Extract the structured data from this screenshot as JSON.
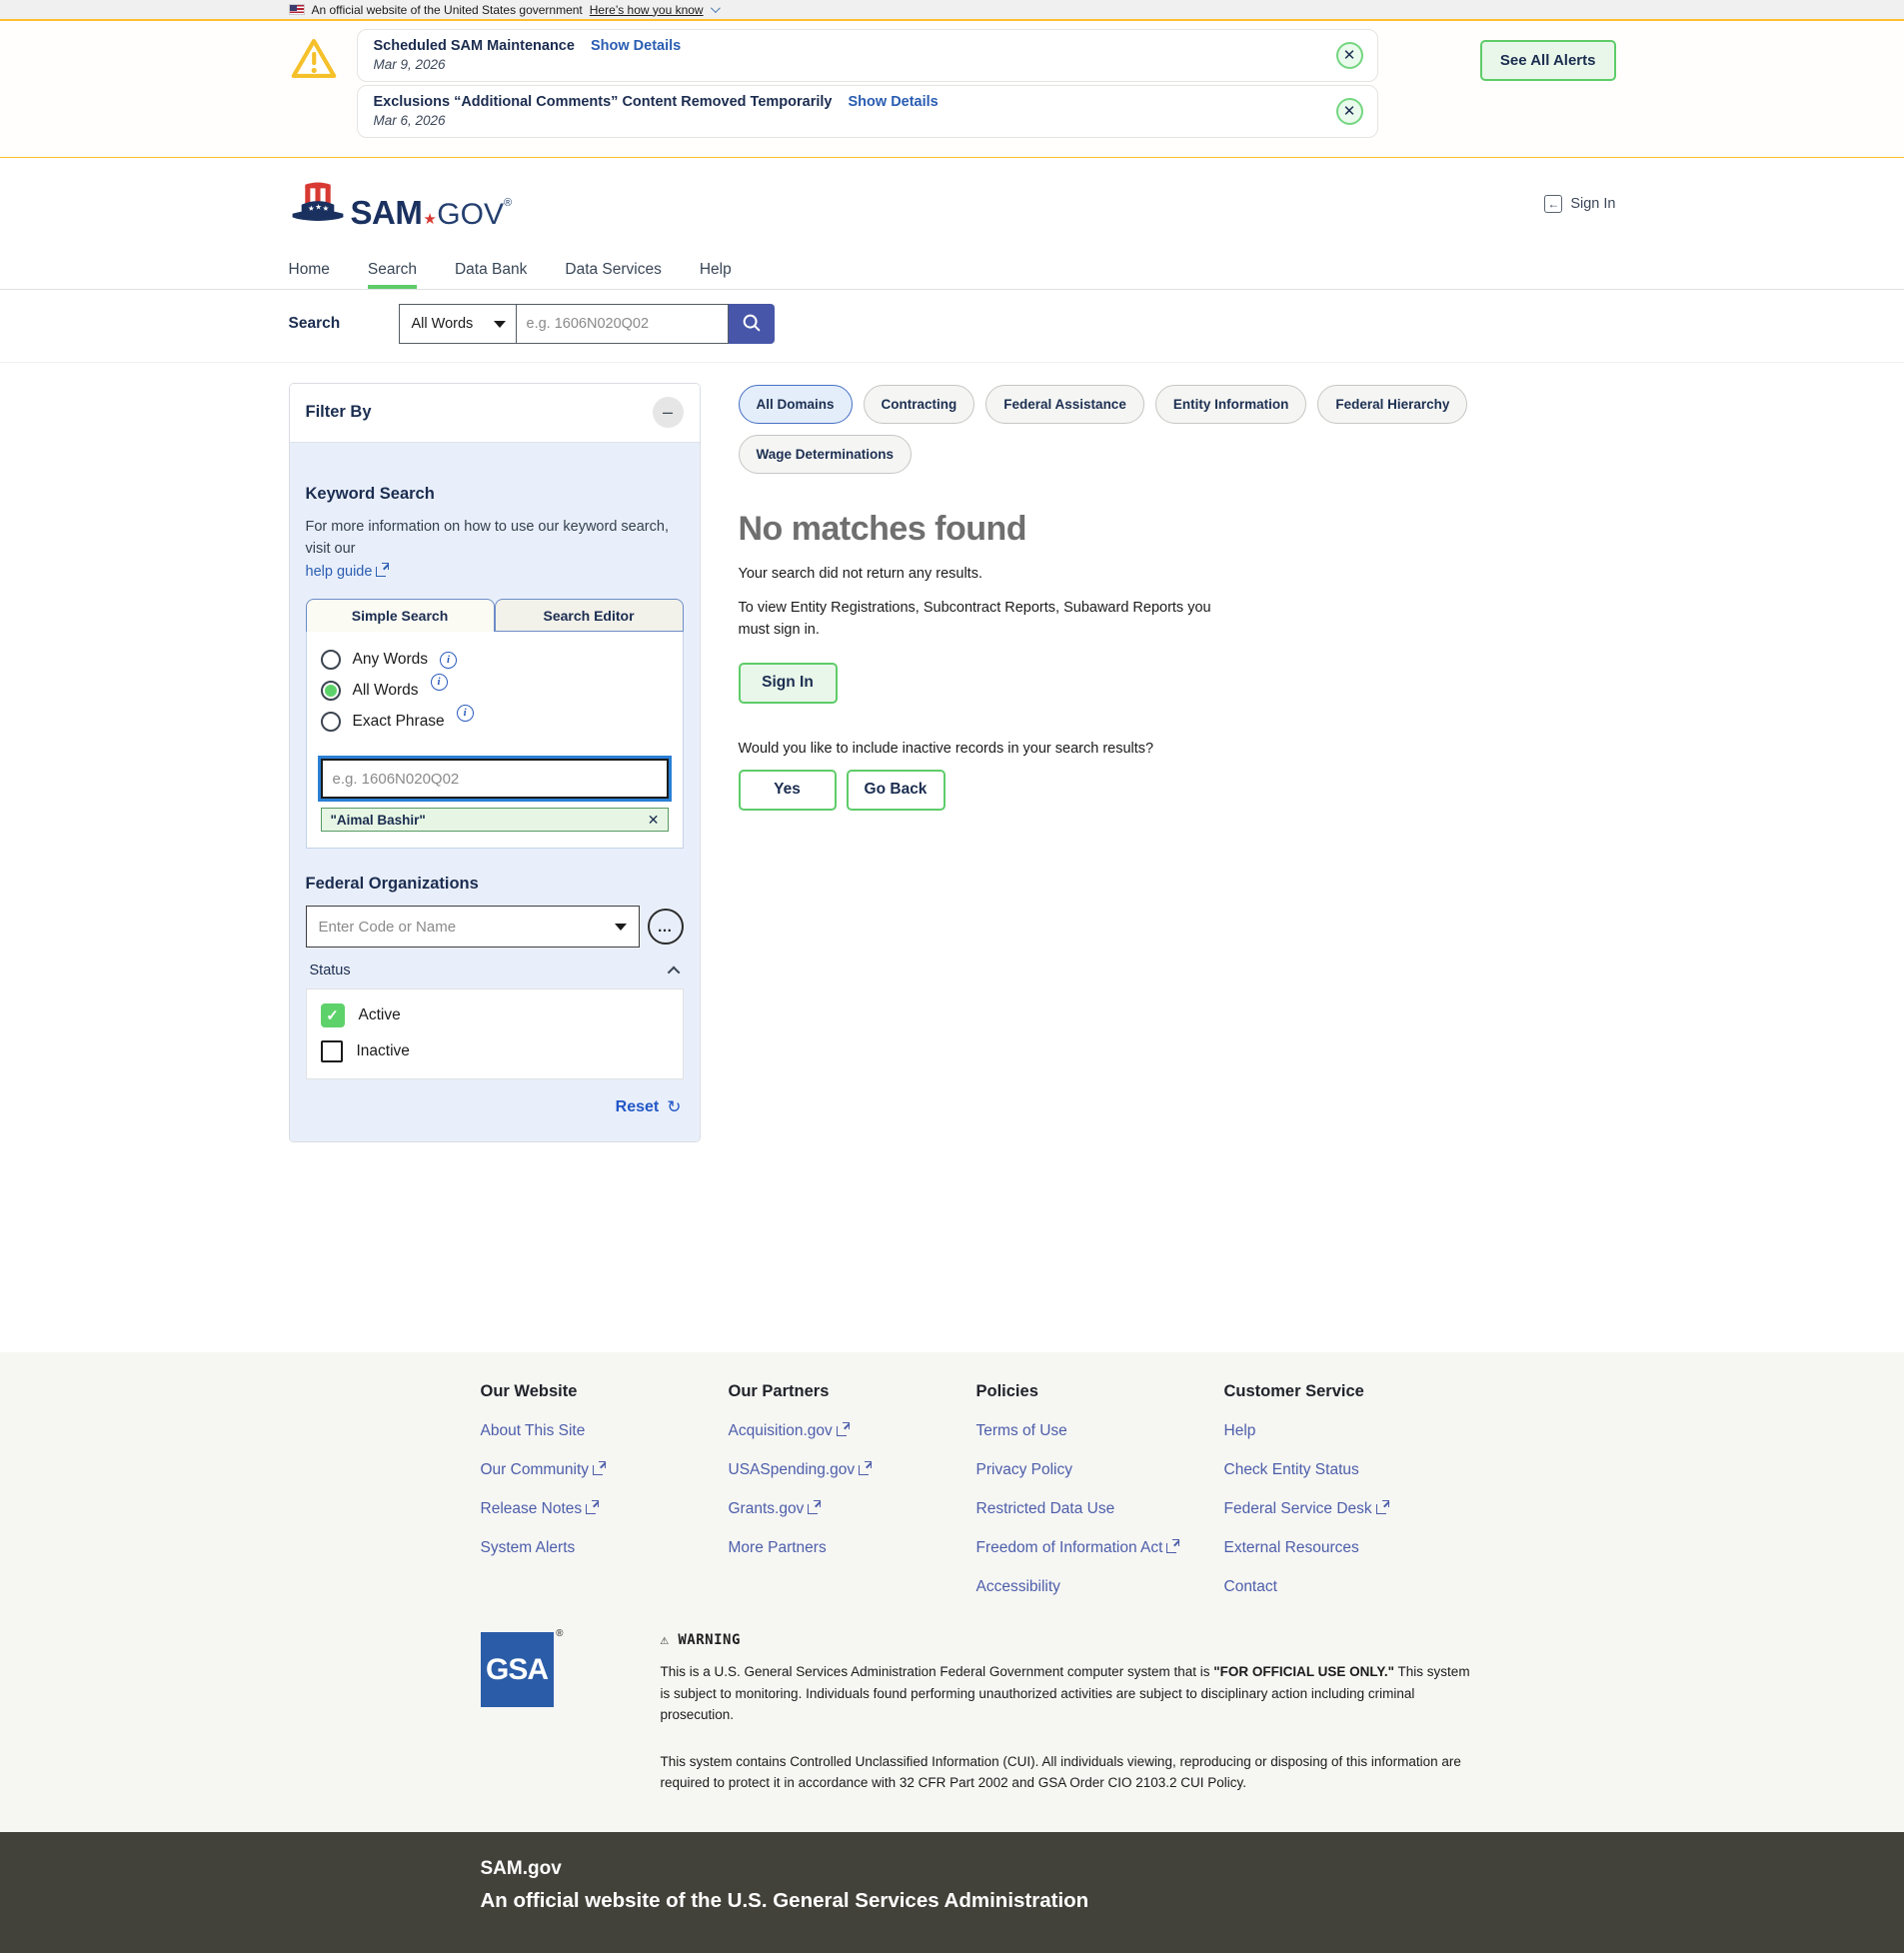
{
  "banner": {
    "text": "An official website of the United States government",
    "link": "Here’s how you know"
  },
  "alerts": {
    "items": [
      {
        "title": "Scheduled SAM Maintenance",
        "link": "Show Details",
        "date": "Mar 9, 2026"
      },
      {
        "title": "Exclusions “Additional Comments” Content Removed Temporarily",
        "link": "Show Details",
        "date": "Mar 6, 2026"
      }
    ],
    "see_all_label": "See All Alerts"
  },
  "header": {
    "logo_sam": "SAM",
    "logo_star": "★",
    "logo_gov": "GOV",
    "logo_reg": "®",
    "sign_in": "Sign In"
  },
  "nav": {
    "items": [
      {
        "label": "Home"
      },
      {
        "label": "Search"
      },
      {
        "label": "Data Bank"
      },
      {
        "label": "Data Services"
      },
      {
        "label": "Help"
      }
    ]
  },
  "searchbar": {
    "label": "Search",
    "mode_value": "All Words",
    "placeholder": "e.g. 1606N020Q02"
  },
  "filter": {
    "title": "Filter By",
    "keyword": {
      "heading": "Keyword Search",
      "info": "For more information on how to use our keyword search, visit our",
      "help_link": "help guide",
      "tabs": [
        {
          "label": "Simple Search"
        },
        {
          "label": "Search Editor"
        }
      ],
      "radios": [
        {
          "label": "Any Words"
        },
        {
          "label": "All Words"
        },
        {
          "label": "Exact Phrase"
        }
      ],
      "input_placeholder": "e.g. 1606N020Q02",
      "chip_label": "\"Aimal Bashir\""
    },
    "federal_orgs": {
      "heading": "Federal Organizations",
      "placeholder": "Enter Code or Name"
    },
    "status": {
      "heading": "Status",
      "options": [
        {
          "label": "Active",
          "checked": true
        },
        {
          "label": "Inactive",
          "checked": false
        }
      ]
    },
    "reset_label": "Reset"
  },
  "results": {
    "domains": [
      {
        "label": "All Domains"
      },
      {
        "label": "Contracting"
      },
      {
        "label": "Federal Assistance"
      },
      {
        "label": "Entity Information"
      },
      {
        "label": "Federal Hierarchy"
      },
      {
        "label": "Wage Determinations"
      }
    ],
    "title": "No matches found",
    "subtitle": "Your search did not return any results.",
    "signin_note": "To view Entity Registrations, Subcontract Reports, Subaward Reports you must sign in.",
    "signin_button": "Sign In",
    "inactive_question": "Would you like to include inactive records in your search results?",
    "yes_button": "Yes",
    "goback_button": "Go Back"
  },
  "footer": {
    "columns": [
      {
        "heading": "Our Website",
        "links": [
          {
            "label": "About This Site"
          },
          {
            "label": "Our Community"
          },
          {
            "label": "Release Notes"
          },
          {
            "label": "System Alerts"
          }
        ]
      },
      {
        "heading": "Our Partners",
        "links": [
          {
            "label": "Acquisition.gov"
          },
          {
            "label": "USASpending.gov"
          },
          {
            "label": "Grants.gov"
          },
          {
            "label": "More Partners"
          }
        ]
      },
      {
        "heading": "Policies",
        "links": [
          {
            "label": "Terms of Use"
          },
          {
            "label": "Privacy Policy"
          },
          {
            "label": "Restricted Data Use"
          },
          {
            "label": "Freedom of Information Act"
          },
          {
            "label": "Accessibility"
          }
        ]
      },
      {
        "heading": "Customer Service",
        "links": [
          {
            "label": "Help"
          },
          {
            "label": "Check Entity Status"
          },
          {
            "label": "Federal Service Desk"
          },
          {
            "label": "External Resources"
          },
          {
            "label": "Contact"
          }
        ]
      }
    ],
    "gsa": {
      "logo": "GSA",
      "logo_reg": "®",
      "warning_title": "WARNING",
      "p1_pre": "This is a U.S. General Services Administration Federal Government computer system that is ",
      "p1_bold": "\"FOR OFFICIAL USE ONLY.\"",
      "p1_post": " This system is subject to monitoring. Individuals found performing unauthorized activities are subject to disciplinary action including criminal prosecution.",
      "p2": "This system contains Controlled Unclassified Information (CUI). All individuals viewing, reproducing or disposing of this information are required to protect it in accordance with 32 CFR Part 2002 and GSA Order CIO 2103.2 CUI Policy."
    },
    "bottom": {
      "title": "SAM.gov",
      "subtitle": "An official website of the U.S. General Services Administration"
    }
  },
  "icons": {
    "close_x": "✕",
    "minus": "–",
    "ellipsis": "…",
    "check": "✓",
    "refresh": "↻",
    "warning_sign": "⚠",
    "enter_arrow": "←",
    "info_i": "i"
  },
  "colors": {
    "accent_green": "#5ecc69",
    "gold": "#ffbe2e",
    "navy": "#1b2d50",
    "link_blue": "#2a5db2",
    "search_button_indigo": "#4756a8",
    "footer_dark": "#42423a",
    "gsa_blue": "#2a5ca8"
  }
}
